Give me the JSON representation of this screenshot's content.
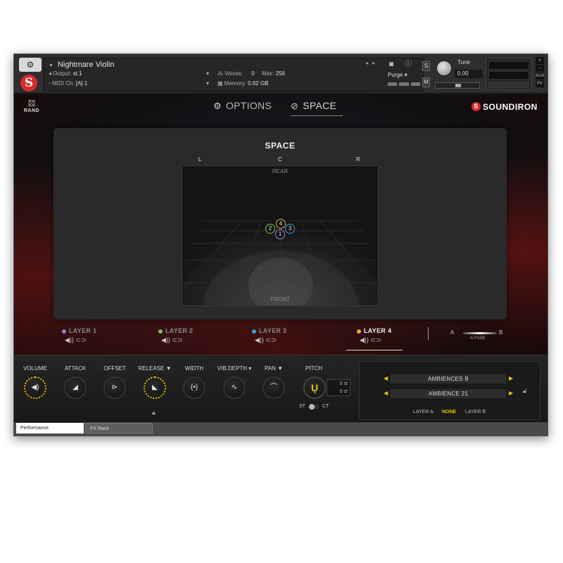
{
  "header": {
    "instrument_name": "Nightmare Violin",
    "output_label": "Output:",
    "output_value": "st.1",
    "midi_label": "MIDI Ch:",
    "midi_value": "[A] 1",
    "voices_label": "Voices:",
    "voices_value": "0",
    "max_label": "Max:",
    "max_value": "256",
    "memory_label": "Memory:",
    "memory_value": "0.62 GB",
    "purge_label": "Purge",
    "s_button": "S",
    "m_button": "M",
    "tune_label": "Tune",
    "tune_value": "0.00",
    "side_buttons": [
      "x",
      "–",
      "AUX",
      "PV"
    ]
  },
  "nav": {
    "rand_label": "RAND",
    "tabs": [
      {
        "label": "OPTIONS",
        "icon": "gear-icon"
      },
      {
        "label": "SPACE",
        "icon": "space-icon"
      }
    ],
    "brand": "SOUNDIRON",
    "brand_icon": "S"
  },
  "space": {
    "title": "SPACE",
    "left_label": "L",
    "center_label": "C",
    "right_label": "R",
    "rear_label": "REAR",
    "front_label": "FRONT",
    "dots": [
      {
        "label": "4",
        "color": "#e6a830"
      },
      {
        "label": "2",
        "color": "#6ec24a"
      },
      {
        "label": "3",
        "color": "#3aa0d8"
      },
      {
        "label": "1",
        "color": "#9b7ce0"
      }
    ]
  },
  "layers": [
    {
      "label": "LAYER 1",
      "color": "#9b7ce0"
    },
    {
      "label": "LAYER 2",
      "color": "#6ec24a"
    },
    {
      "label": "LAYER 3",
      "color": "#3aa0d8"
    },
    {
      "label": "LAYER 4",
      "color": "#e6a830"
    }
  ],
  "xfade": {
    "a": "A",
    "b": "B",
    "label": "X-FADE"
  },
  "controls": {
    "knobs": [
      "VOLUME",
      "ATTACK",
      "OFFSET",
      "RELEASE ▼",
      "WIDTH",
      "VIB.DEPTH ▾",
      "PAN ▼"
    ],
    "pitch_label": "PITCH",
    "pitch_st": "0 st",
    "pitch_ct": "0 ct",
    "st_label": "ST",
    "ct_label": "CT"
  },
  "ambience": {
    "row1": "AMBIENCES B",
    "row2": "AMBIENCE 21",
    "options": [
      "LAYER A",
      "NONE",
      "LAYER B"
    ]
  },
  "bottom_tabs": [
    "Performance",
    "FX Rack"
  ],
  "colors": {
    "accent": "#e6c200",
    "brand_red": "#d62b2b"
  }
}
